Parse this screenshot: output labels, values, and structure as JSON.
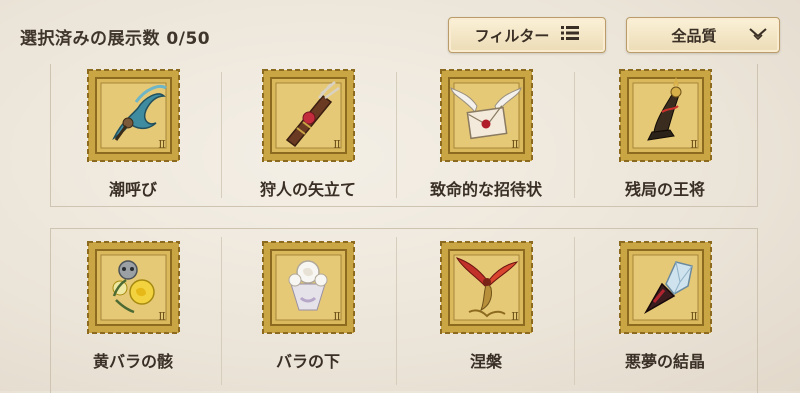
{
  "header": {
    "selection_label": "選択済みの展示数 0/50"
  },
  "toolbar": {
    "filter_label": "フィルター",
    "quality_label": "全品質"
  },
  "items": [
    {
      "label": "潮呼び",
      "icon": "sea-serpent-icon"
    },
    {
      "label": "狩人の矢立て",
      "icon": "quiver-icon"
    },
    {
      "label": "致命的な招待状",
      "icon": "winged-letter-icon"
    },
    {
      "label": "残局の王将",
      "icon": "chess-king-icon"
    },
    {
      "label": "黄バラの骸",
      "icon": "yellow-rose-icon"
    },
    {
      "label": "バラの下",
      "icon": "white-rose-icon"
    },
    {
      "label": "涅槃",
      "icon": "phoenix-icon"
    },
    {
      "label": "悪夢の結晶",
      "icon": "crystal-icon"
    }
  ],
  "stamp_mark": "Ⅱ",
  "colors": {
    "stamp_gold": "#c9a544",
    "stamp_dark": "#8c6a1f",
    "stamp_light": "#ecd48a"
  }
}
